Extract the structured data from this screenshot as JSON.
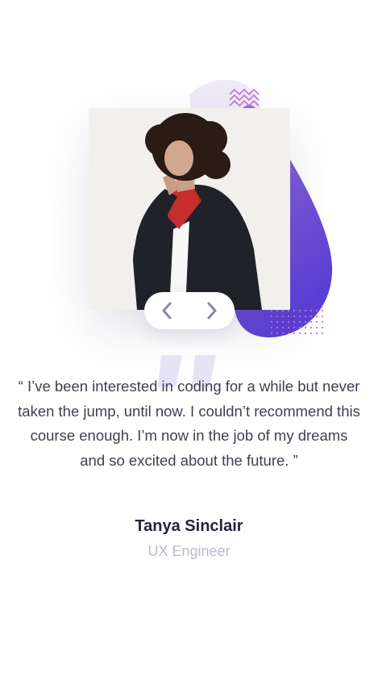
{
  "testimonial": {
    "quote": "“ I’ve been interested in coding for a while but never taken the jump, until now. I couldn’t recommend this course enough. I’m now in the job of my dreams and so excited about the future. ”",
    "author_name": "Tanya Sinclair",
    "author_role": "UX Engineer"
  },
  "navigation": {
    "prev_icon": "chevron-left-icon",
    "next_icon": "chevron-right-icon"
  },
  "colors": {
    "accent_purple": "#6c4bd1",
    "accent_pink": "#c873c9",
    "text_primary": "#3d3f52",
    "name_color": "#24253d",
    "role_color": "#b9bacb",
    "chevron_color": "#8a8aa8"
  }
}
